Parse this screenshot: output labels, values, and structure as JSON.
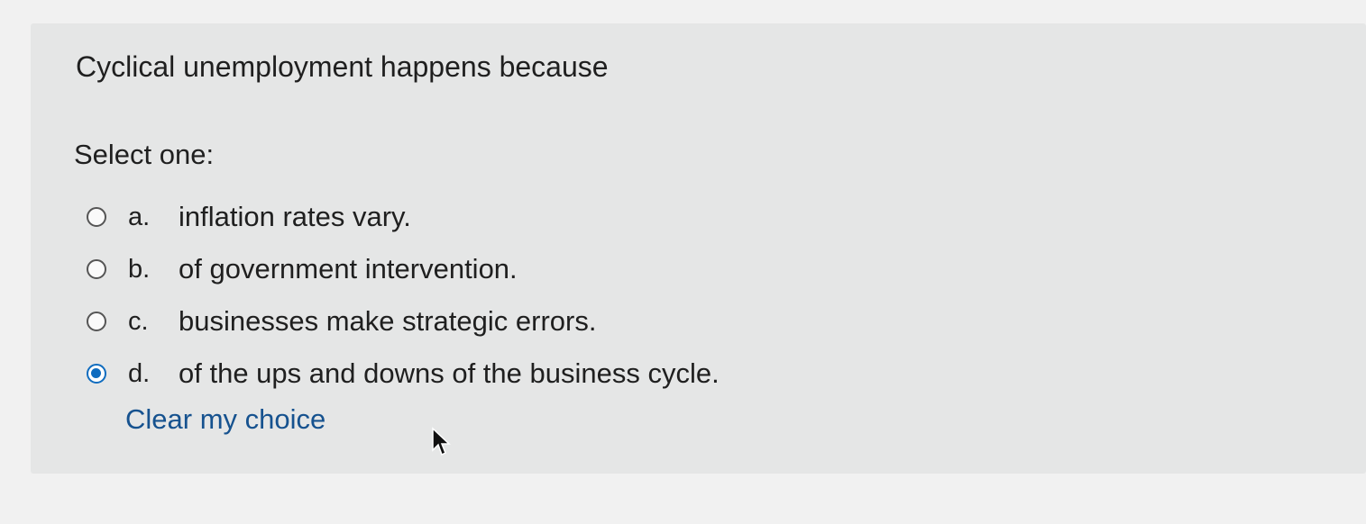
{
  "question": {
    "text": "Cyclical unemployment happens because",
    "prompt": "Select one:",
    "options": [
      {
        "letter": "a.",
        "text": "inflation rates vary.",
        "selected": false
      },
      {
        "letter": "b.",
        "text": "of government intervention.",
        "selected": false
      },
      {
        "letter": "c.",
        "text": "businesses make strategic errors.",
        "selected": false
      },
      {
        "letter": "d.",
        "text": "of the ups and downs of the business cycle.",
        "selected": true
      }
    ],
    "clear_label": "Clear my choice"
  },
  "colors": {
    "background": "#f1f1f1",
    "card": "#e5e6e6",
    "accent": "#0f6cbf",
    "link": "#16528f"
  },
  "icons": {
    "cursor": "arrow-cursor-icon"
  }
}
